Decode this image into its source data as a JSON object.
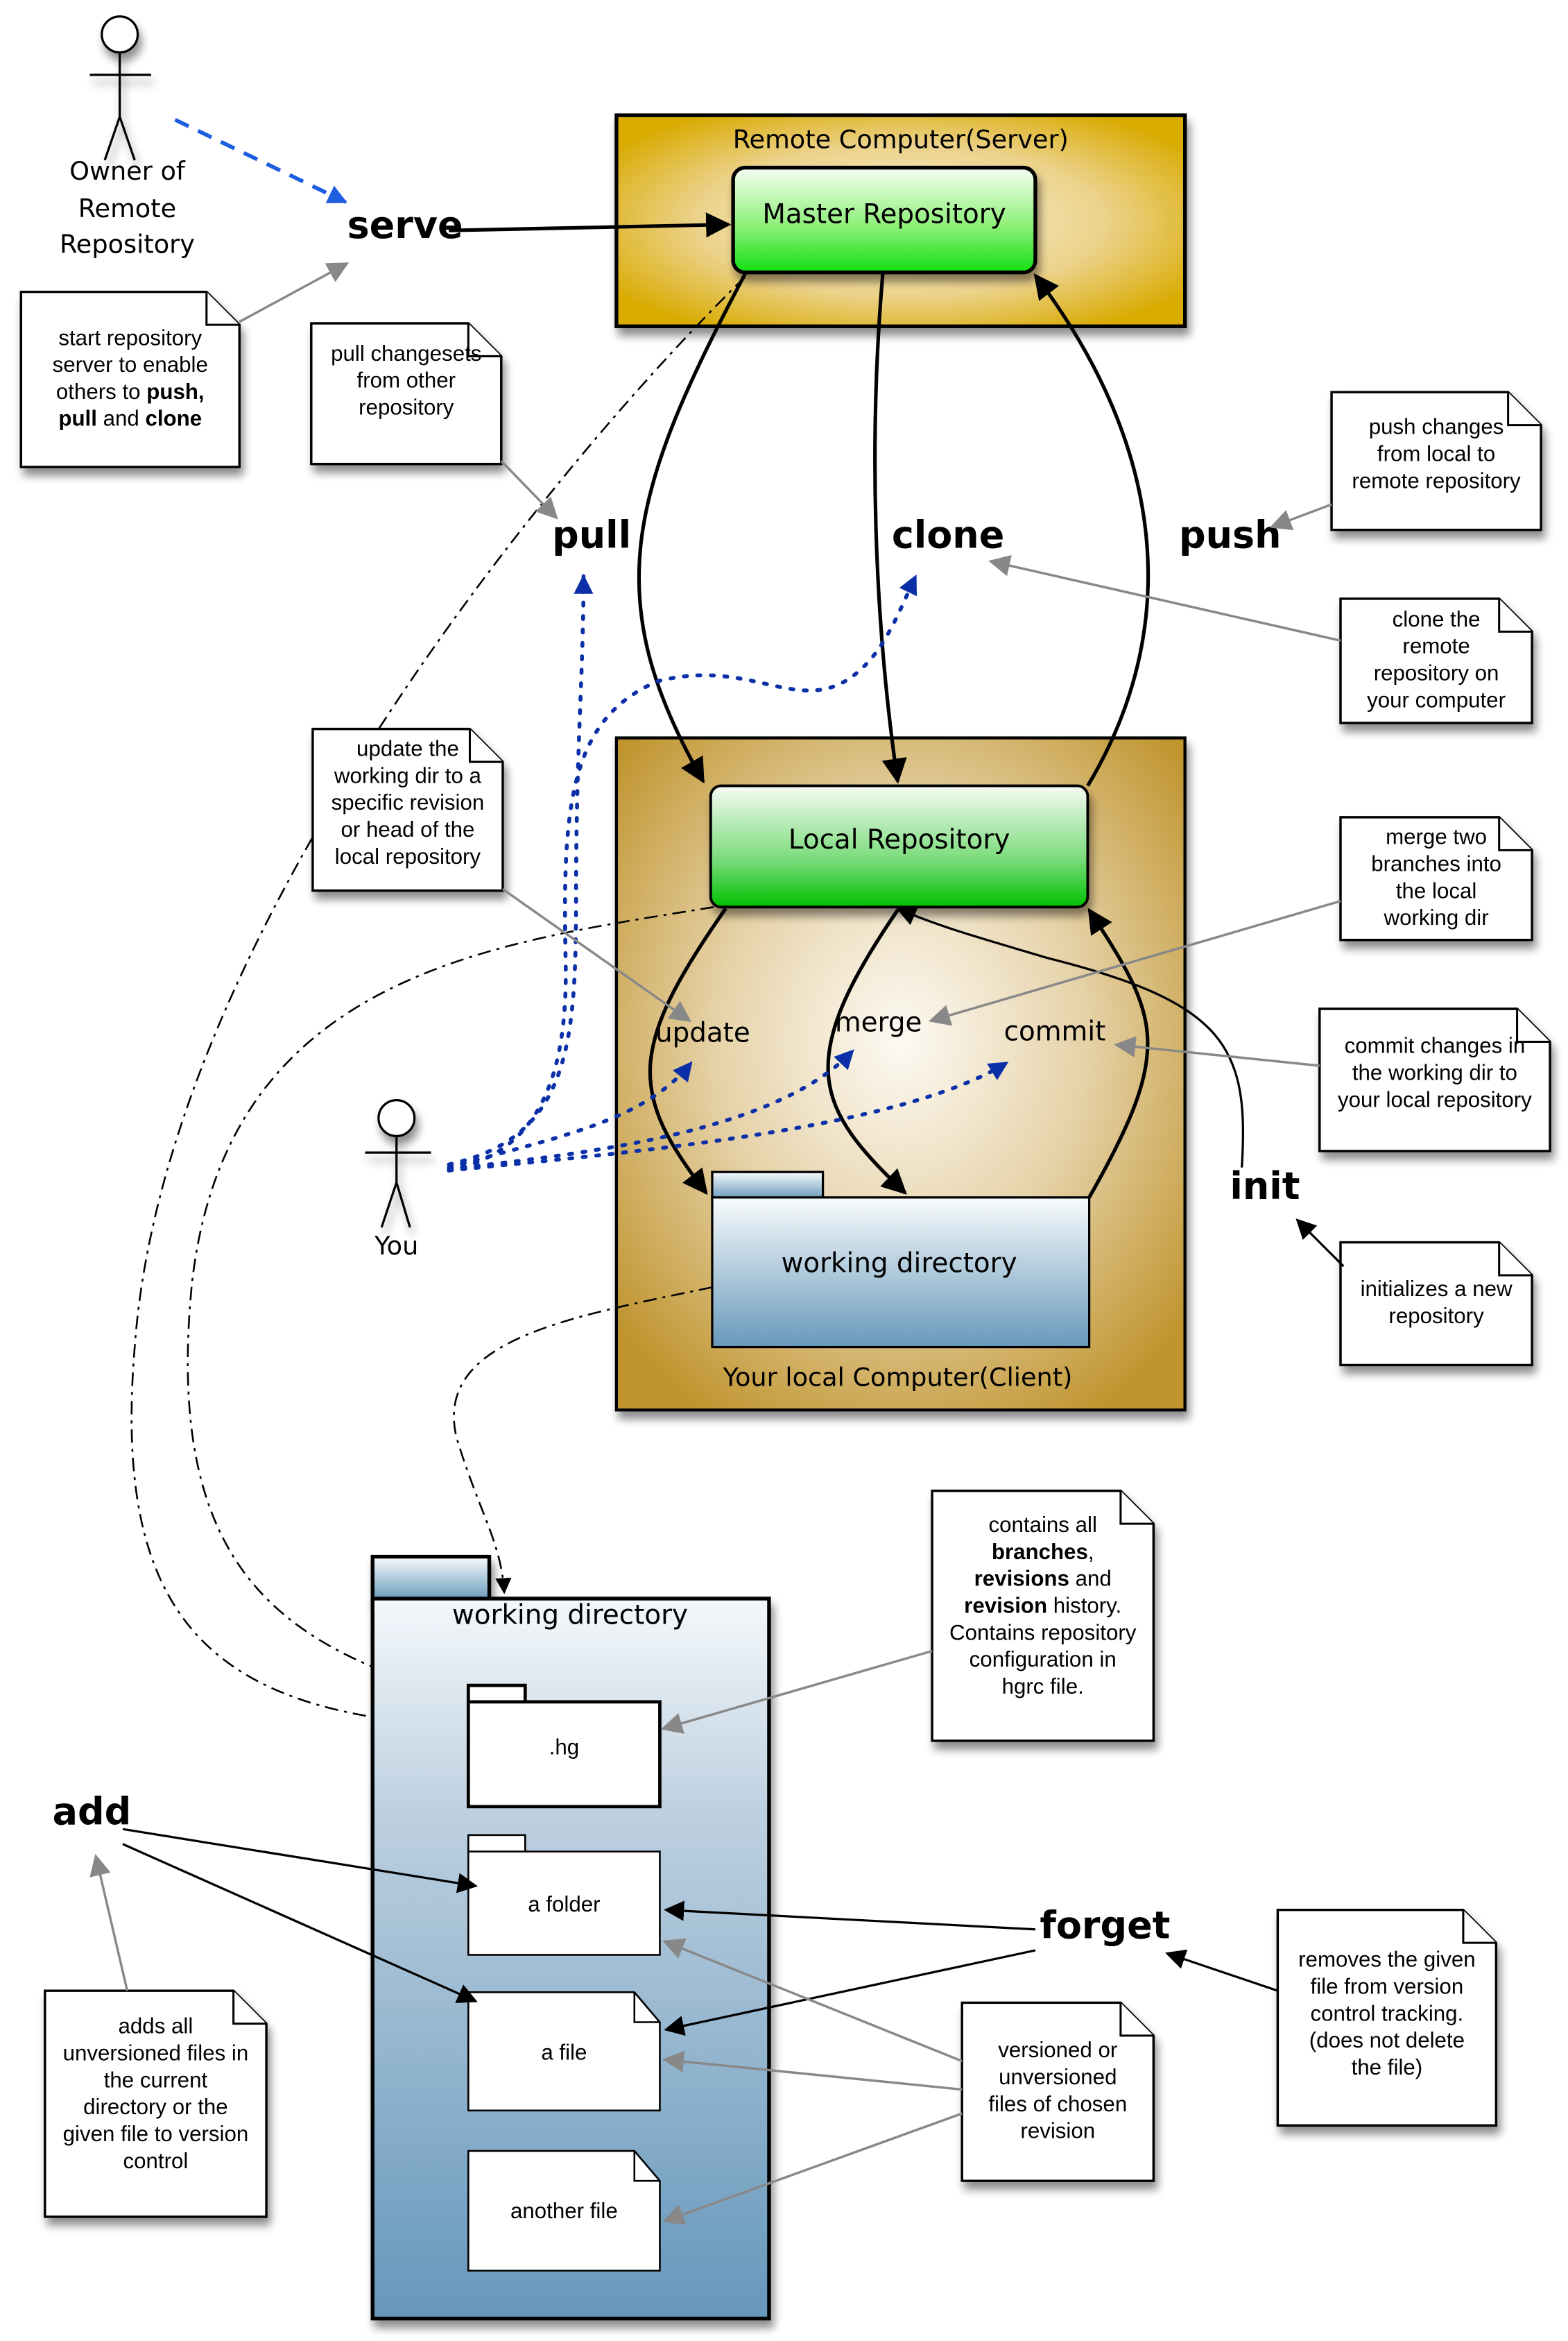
{
  "actors": {
    "owner": [
      "Owner of",
      "Remote",
      "Repository"
    ],
    "you": "You"
  },
  "remote": {
    "title": "Remote Computer(Server)",
    "master": "Master Repository"
  },
  "local": {
    "title": "Your local Computer(Client)",
    "repo": "Local Repository",
    "working_dir": "working directory"
  },
  "commands": {
    "serve": "serve",
    "pull": "pull",
    "clone": "clone",
    "push": "push",
    "update": "update",
    "merge": "merge",
    "commit": "commit",
    "init": "init",
    "add": "add",
    "forget": "forget"
  },
  "notes": {
    "serve": [
      "start repository",
      "server to enable",
      "others to |push,|",
      "|pull| and |clone|"
    ],
    "pull": [
      "pull changesets",
      "from other",
      "repository"
    ],
    "push": [
      "push changes",
      "from local to",
      "remote repository"
    ],
    "clone": [
      "clone the",
      "remote",
      "repository on",
      "your computer"
    ],
    "update": [
      "update the",
      "working dir to a",
      "specific revision",
      "or head of the",
      "local repository"
    ],
    "merge": [
      "merge two",
      "branches into",
      "the local",
      "working dir"
    ],
    "commit": [
      "commit changes in",
      "the working dir to",
      "your local repository"
    ],
    "init": [
      "initializes a new",
      "repository"
    ],
    "hg": [
      "contains all",
      "|branches|,",
      "|revisions| and",
      "|revision| history.",
      "Contains repository",
      "configuration in",
      "hgrc file."
    ],
    "add": [
      "adds all",
      "unversioned files in",
      "the current",
      "directory or the",
      "given file to version",
      "control"
    ],
    "forget": [
      "removes the given",
      "file from version",
      "control tracking.",
      "(does not delete",
      "the file)"
    ],
    "versioned": [
      "versioned or",
      "unversioned",
      "files of chosen",
      "revision"
    ]
  },
  "working_tree": {
    "title": "working directory",
    "items": [
      ".hg",
      "a folder",
      "a file",
      "another file"
    ]
  },
  "colors": {
    "remote_gold": "#d9ac06",
    "local_tan": "#c49a3c",
    "repo_green": "#00e600",
    "folder_blue": "#6699bb",
    "pull_blue": "#0a2fa6",
    "serve_blue": "#1d5de0"
  }
}
